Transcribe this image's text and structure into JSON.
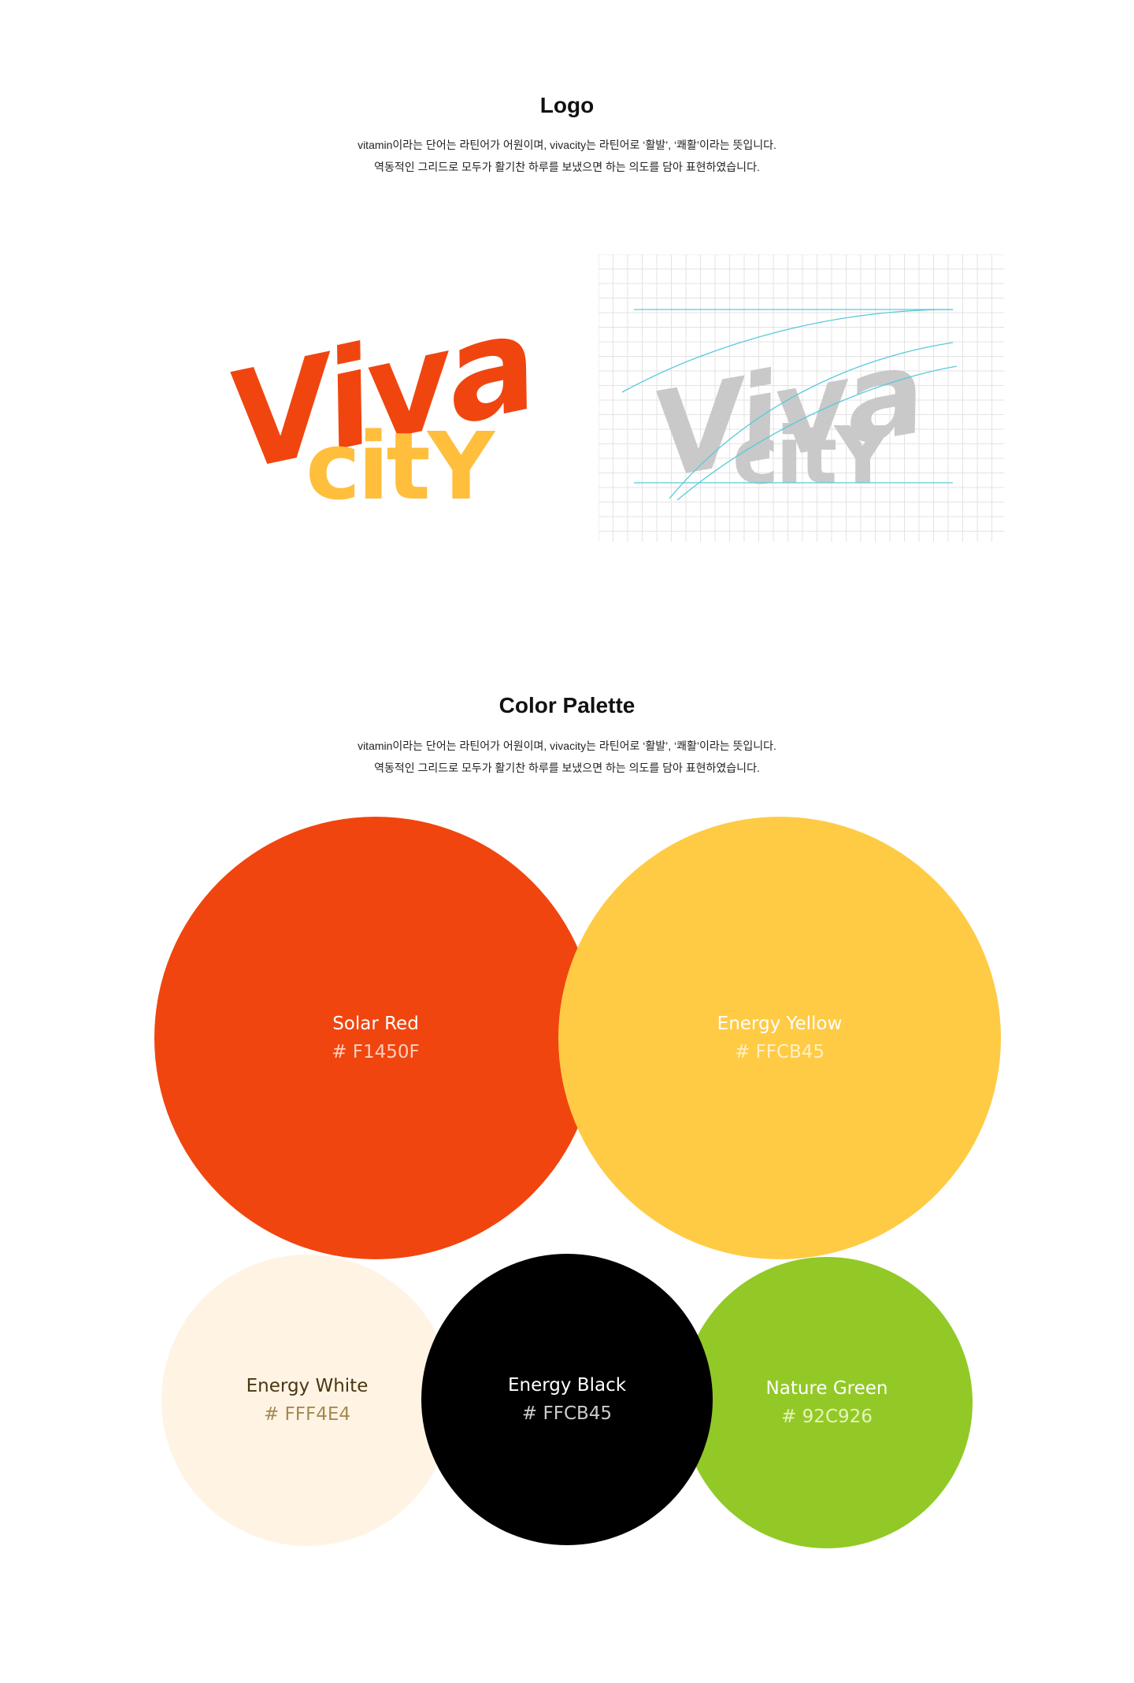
{
  "logo_section": {
    "title": "Logo",
    "desc_line1": "vitamin이라는 단어는 라틴어가 어원이며, vivacity는 라틴어로 ‘활발’, ‘쾌활’이라는 뜻입니다.",
    "desc_line2": "역동적인 그리드로 모두가 활기찬 하루를 보냈으면 하는 의도를 담아 표현하였습니다.",
    "logo_word_top": "Viva",
    "logo_word_bottom": "citY"
  },
  "palette_section": {
    "title": "Color Palette",
    "desc_line1": "vitamin이라는 단어는 라틴어가 어원이며, vivacity는 라틴어로 ‘활발’, ‘쾌활’이라는 뜻입니다.",
    "desc_line2": "역동적인 그리드로 모두가 활기찬 하루를 보냈으면 하는 의도를 담아 표현하였습니다.",
    "colors": [
      {
        "name": "Solar Red",
        "hex": "# F1450F",
        "fill": "#F1450F",
        "text_color": "#FFFFFF",
        "hex_color": "#FDD0BE"
      },
      {
        "name": "Energy Yellow",
        "hex": "# FFCB45",
        "fill": "#FFCB45",
        "text_color": "#FFFFFF",
        "hex_color": "#FFF1C8"
      },
      {
        "name": "Energy White",
        "hex": "# FFF4E4",
        "fill": "#FFF4E4",
        "text_color": "#4A3612",
        "hex_color": "#A48A52"
      },
      {
        "name": "Energy Black",
        "hex": "# FFCB45",
        "fill": "#000000",
        "text_color": "#FFFFFF",
        "hex_color": "#CCCCCC"
      },
      {
        "name": "Nature Green",
        "hex": "# 92C926",
        "fill": "#92C926",
        "text_color": "#FFFFFF",
        "hex_color": "#E6F5BC"
      }
    ]
  },
  "logo_colors": {
    "viva": "#F1450F",
    "city": "#FFBE3C",
    "grid_logo": "#C9C9C9",
    "guide": "#59C9DA",
    "grid_line": "#E3E3E3"
  }
}
